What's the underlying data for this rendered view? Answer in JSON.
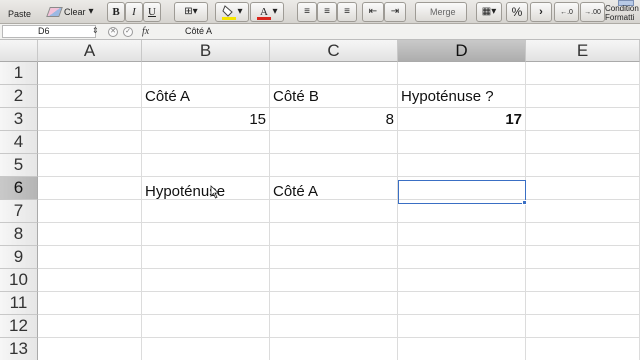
{
  "toolbar": {
    "paste_label": "Paste",
    "clear_label": "Clear",
    "bold_label": "B",
    "italic_label": "I",
    "underline_label": "U",
    "merge_label": "Merge",
    "percent_label": "%",
    "comma_label": "›",
    "inc_decimal_label": "←.0",
    "dec_decimal_label": "→.00",
    "conditional_label": "Condition Formatti",
    "fill_color": "#f5e400",
    "font_color": "#d9261c"
  },
  "formula_bar": {
    "cell_ref": "D6",
    "fx_label": "fx",
    "content": "Côté A"
  },
  "columns": [
    "A",
    "B",
    "C",
    "D",
    "E"
  ],
  "selected_column": "D",
  "rows": [
    "1",
    "2",
    "3",
    "4",
    "5",
    "6",
    "7",
    "8",
    "9",
    "10",
    "11",
    "12",
    "13"
  ],
  "selected_row": "6",
  "cells": {
    "B2": "Côté A",
    "C2": "Côté B",
    "D2": "Hypoténuse ?",
    "B3": "15",
    "C3": "8",
    "D3": "17",
    "B6": "Hypoténuse",
    "C6": "Côté A"
  }
}
